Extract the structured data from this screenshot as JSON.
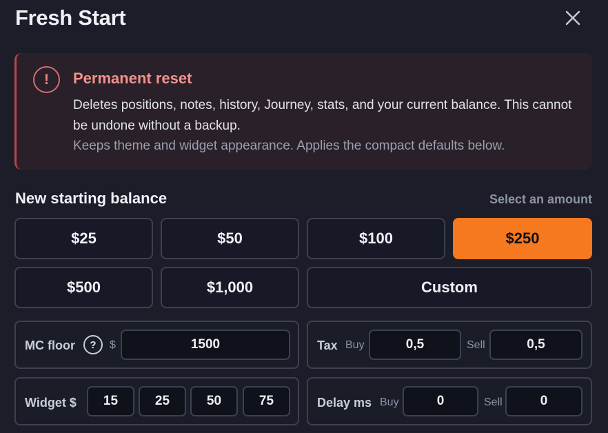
{
  "dialog": {
    "title": "Fresh Start",
    "close_icon": "close-icon"
  },
  "warning": {
    "icon": "exclamation-icon",
    "icon_glyph": "!",
    "title": "Permanent reset",
    "body": "Deletes positions, notes, history, Journey, stats, and your current balance. This cannot be undone without a backup.",
    "note": "Keeps theme and widget appearance. Applies the compact defaults below.",
    "accent_color": "#f2928c"
  },
  "balance": {
    "title": "New starting balance",
    "hint": "Select an amount",
    "options": [
      "$25",
      "$50",
      "$100",
      "$250",
      "$500",
      "$1,000",
      "Custom"
    ],
    "selected": "$250",
    "accent_color": "#f6791f"
  },
  "mc_floor": {
    "label": "MC floor",
    "help_glyph": "?",
    "currency": "$",
    "value": "1500"
  },
  "tax": {
    "label": "Tax",
    "buy_label": "Buy",
    "buy_value": "0,5",
    "sell_label": "Sell",
    "sell_value": "0,5"
  },
  "widget": {
    "label": "Widget $",
    "presets": [
      "15",
      "25",
      "50",
      "75"
    ]
  },
  "delay": {
    "label": "Delay ms",
    "buy_label": "Buy",
    "buy_value": "0",
    "sell_label": "Sell",
    "sell_value": "0"
  }
}
